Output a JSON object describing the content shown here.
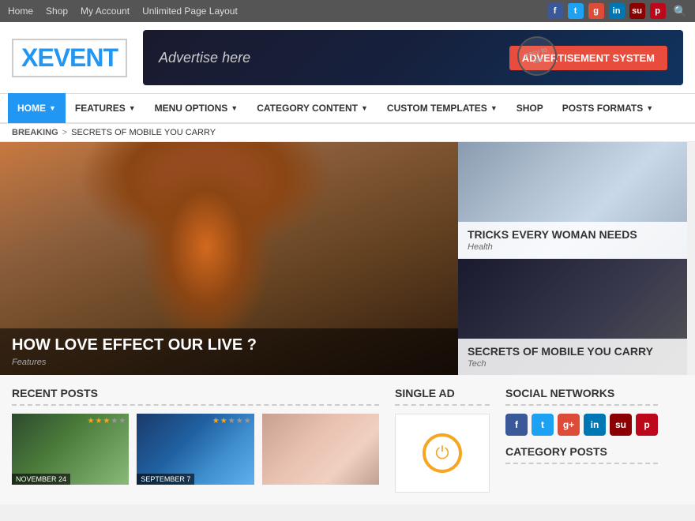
{
  "topNav": {
    "links": [
      "Home",
      "Shop",
      "My Account",
      "Unlimited Page Layout"
    ],
    "socialIcons": [
      "f",
      "t",
      "g+",
      "in",
      "su",
      "p"
    ],
    "searchTitle": "Search"
  },
  "header": {
    "logoPrefix": "X",
    "logoText": "EVENT",
    "adText": "Advertise here",
    "adBadgeText": "easy to use",
    "adSystemLabel": "advertisement SYSTEM"
  },
  "mainNav": {
    "items": [
      {
        "label": "HOME",
        "active": true,
        "hasDropdown": true
      },
      {
        "label": "FEATURES",
        "active": false,
        "hasDropdown": true
      },
      {
        "label": "MENU OPTIONS",
        "active": false,
        "hasDropdown": true
      },
      {
        "label": "CATEGORY CONTENT",
        "active": false,
        "hasDropdown": true
      },
      {
        "label": "CUSTOM TEMPLATES",
        "active": false,
        "hasDropdown": true
      },
      {
        "label": "SHOP",
        "active": false,
        "hasDropdown": false
      },
      {
        "label": "POSTS FORMATS",
        "active": false,
        "hasDropdown": true
      }
    ]
  },
  "breadcrumb": {
    "breaking": "BREAKING",
    "separator": ">",
    "current": "SECRETS OF MOBILE YOU CARRY"
  },
  "hero": {
    "main": {
      "title": "HOW LOVE EFFECT OUR LIVE ?",
      "category": "Features"
    },
    "side1": {
      "title": "TRICKS EVERY WOMAN NEEDS",
      "category": "Health"
    },
    "side2": {
      "title": "SECRETS OF MOBILE YOU CARRY",
      "category": "Tech"
    }
  },
  "recentPosts": {
    "sectionTitle": "RECENT POSTS",
    "posts": [
      {
        "date": "NOVEMBER 24",
        "stars": 3,
        "totalStars": 5
      },
      {
        "date": "SEPTEMBER 7",
        "stars": 2,
        "totalStars": 5
      },
      {
        "date": "",
        "stars": 0,
        "totalStars": 0
      }
    ]
  },
  "singleAd": {
    "sectionTitle": "SINGLE AD"
  },
  "socialNetworks": {
    "sectionTitle": "SOCIAL NETWORKS",
    "icons": [
      "f",
      "t",
      "g+",
      "in",
      "su",
      "p"
    ]
  },
  "categoryPosts": {
    "sectionTitle": "CATEGORY POSTS"
  }
}
